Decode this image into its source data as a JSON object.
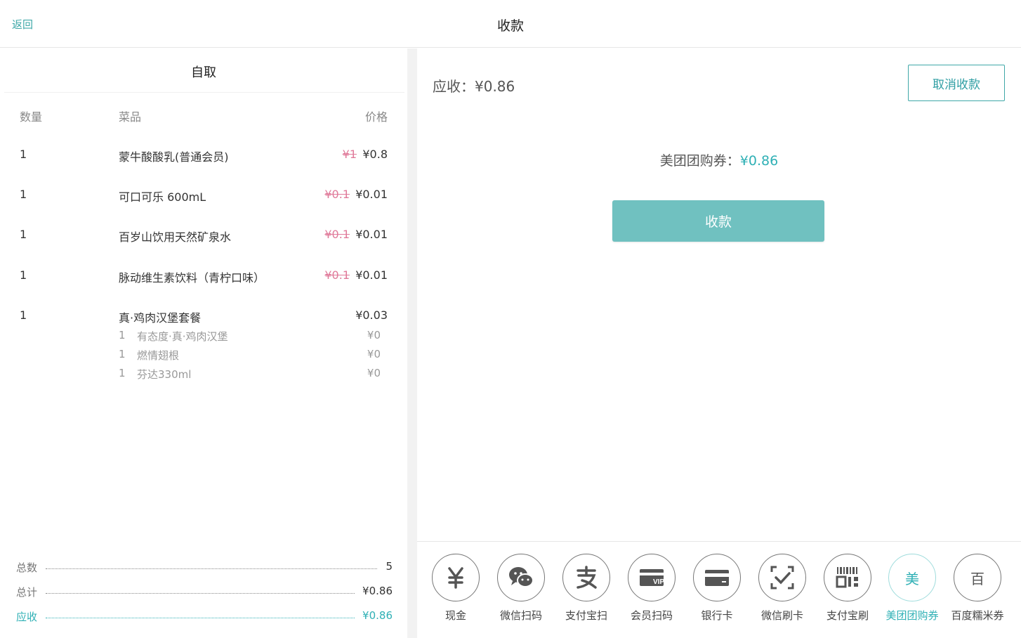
{
  "header": {
    "back_label": "返回",
    "title": "收款"
  },
  "order": {
    "title": "自取",
    "columns": {
      "qty": "数量",
      "item": "菜品",
      "price": "价格"
    },
    "items": [
      {
        "qty": "1",
        "name": "蒙牛酸酸乳(普通会员)",
        "orig": "¥1",
        "price": "¥0.8"
      },
      {
        "qty": "1",
        "name": "可口可乐 600mL",
        "orig": "¥0.1",
        "price": "¥0.01"
      },
      {
        "qty": "1",
        "name": "百岁山饮用天然矿泉水",
        "orig": "¥0.1",
        "price": "¥0.01"
      },
      {
        "qty": "1",
        "name": "脉动维生素饮料（青柠口味）",
        "orig": "¥0.1",
        "price": "¥0.01"
      },
      {
        "qty": "1",
        "name": "真·鸡肉汉堡套餐",
        "orig": "",
        "price": "¥0.03",
        "sub_items": [
          {
            "qty": "1",
            "name": "有态度·真·鸡肉汉堡",
            "price": "¥0"
          },
          {
            "qty": "1",
            "name": "燃情翅根",
            "price": "¥0"
          },
          {
            "qty": "1",
            "name": "芬达330ml",
            "price": "¥0"
          }
        ]
      }
    ],
    "summary": {
      "count_label": "总数",
      "count_value": "5",
      "total_label": "总计",
      "total_value": "¥0.86",
      "due_label": "应收",
      "due_value": "¥0.86"
    }
  },
  "payment": {
    "due_text": "应收：¥0.86",
    "cancel_label": "取消收款",
    "voucher_label": "美团团购券：",
    "voucher_amount": "¥0.86",
    "pay_label": "收款",
    "methods": [
      {
        "label": "现金",
        "icon": "yuan-icon"
      },
      {
        "label": "微信扫码",
        "icon": "wechat-icon"
      },
      {
        "label": "支付宝扫",
        "icon": "alipay-icon"
      },
      {
        "label": "会员扫码",
        "icon": "vip-card-icon"
      },
      {
        "label": "银行卡",
        "icon": "bank-card-icon"
      },
      {
        "label": "微信刷卡",
        "icon": "scan-check-icon"
      },
      {
        "label": "支付宝刷",
        "icon": "barcode-icon"
      },
      {
        "label": "美团团购券",
        "icon": "meituan-icon",
        "glyph": "美",
        "active": true
      },
      {
        "label": "百度糯米券",
        "icon": "baidu-nuomi-icon",
        "glyph": "百"
      }
    ]
  },
  "colors": {
    "accent": "#2fb0b5",
    "pay_button": "#70c1c0",
    "strike": "#e07a9a"
  }
}
